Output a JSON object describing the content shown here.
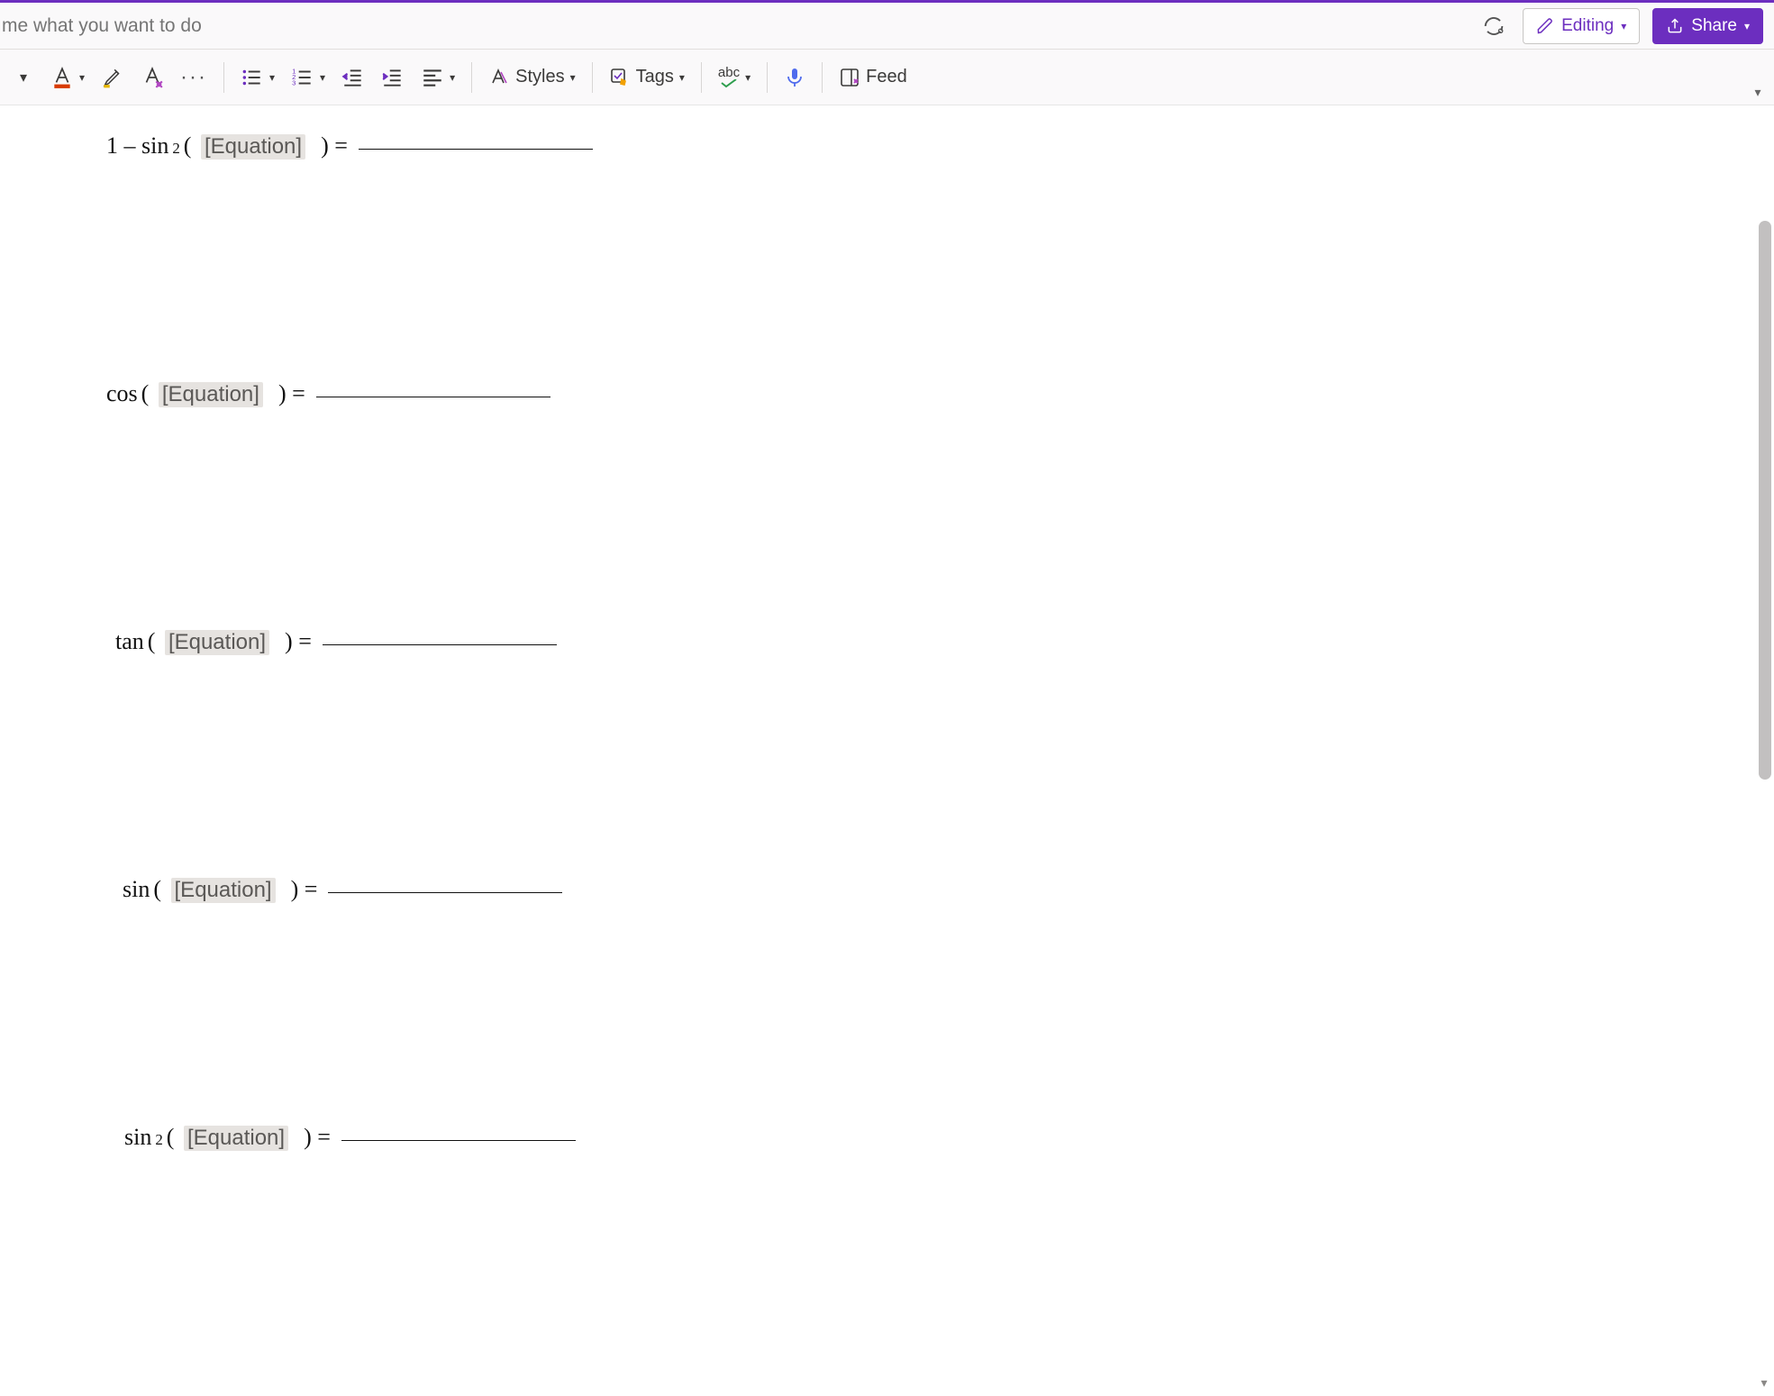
{
  "accent_color": "#6c2ebf",
  "tellme": {
    "placeholder": "me what you want to do"
  },
  "header": {
    "editing_label": "Editing",
    "share_label": "Share"
  },
  "ribbon": {
    "styles_label": "Styles",
    "tags_label": "Tags",
    "feed_label": "Feed",
    "abc_label": "abc"
  },
  "document": {
    "equation_placeholder": "[Equation]",
    "lines": [
      {
        "prefix": "1 – sin",
        "sup": "2",
        "open": "(",
        "close": " ) =",
        "indent": "indent-a"
      },
      {
        "prefix": "cos",
        "sup": "",
        "open": "(",
        "close": " ) =",
        "indent": "indent-b"
      },
      {
        "prefix": "tan",
        "sup": "",
        "open": "(",
        "close": " ) =",
        "indent": "indent-c"
      },
      {
        "prefix": "sin",
        "sup": "",
        "open": "(",
        "close": " ) =",
        "indent": "indent-d"
      },
      {
        "prefix": "sin",
        "sup": "2",
        "open": "(",
        "close": " ) =",
        "indent": "indent-e"
      }
    ]
  }
}
